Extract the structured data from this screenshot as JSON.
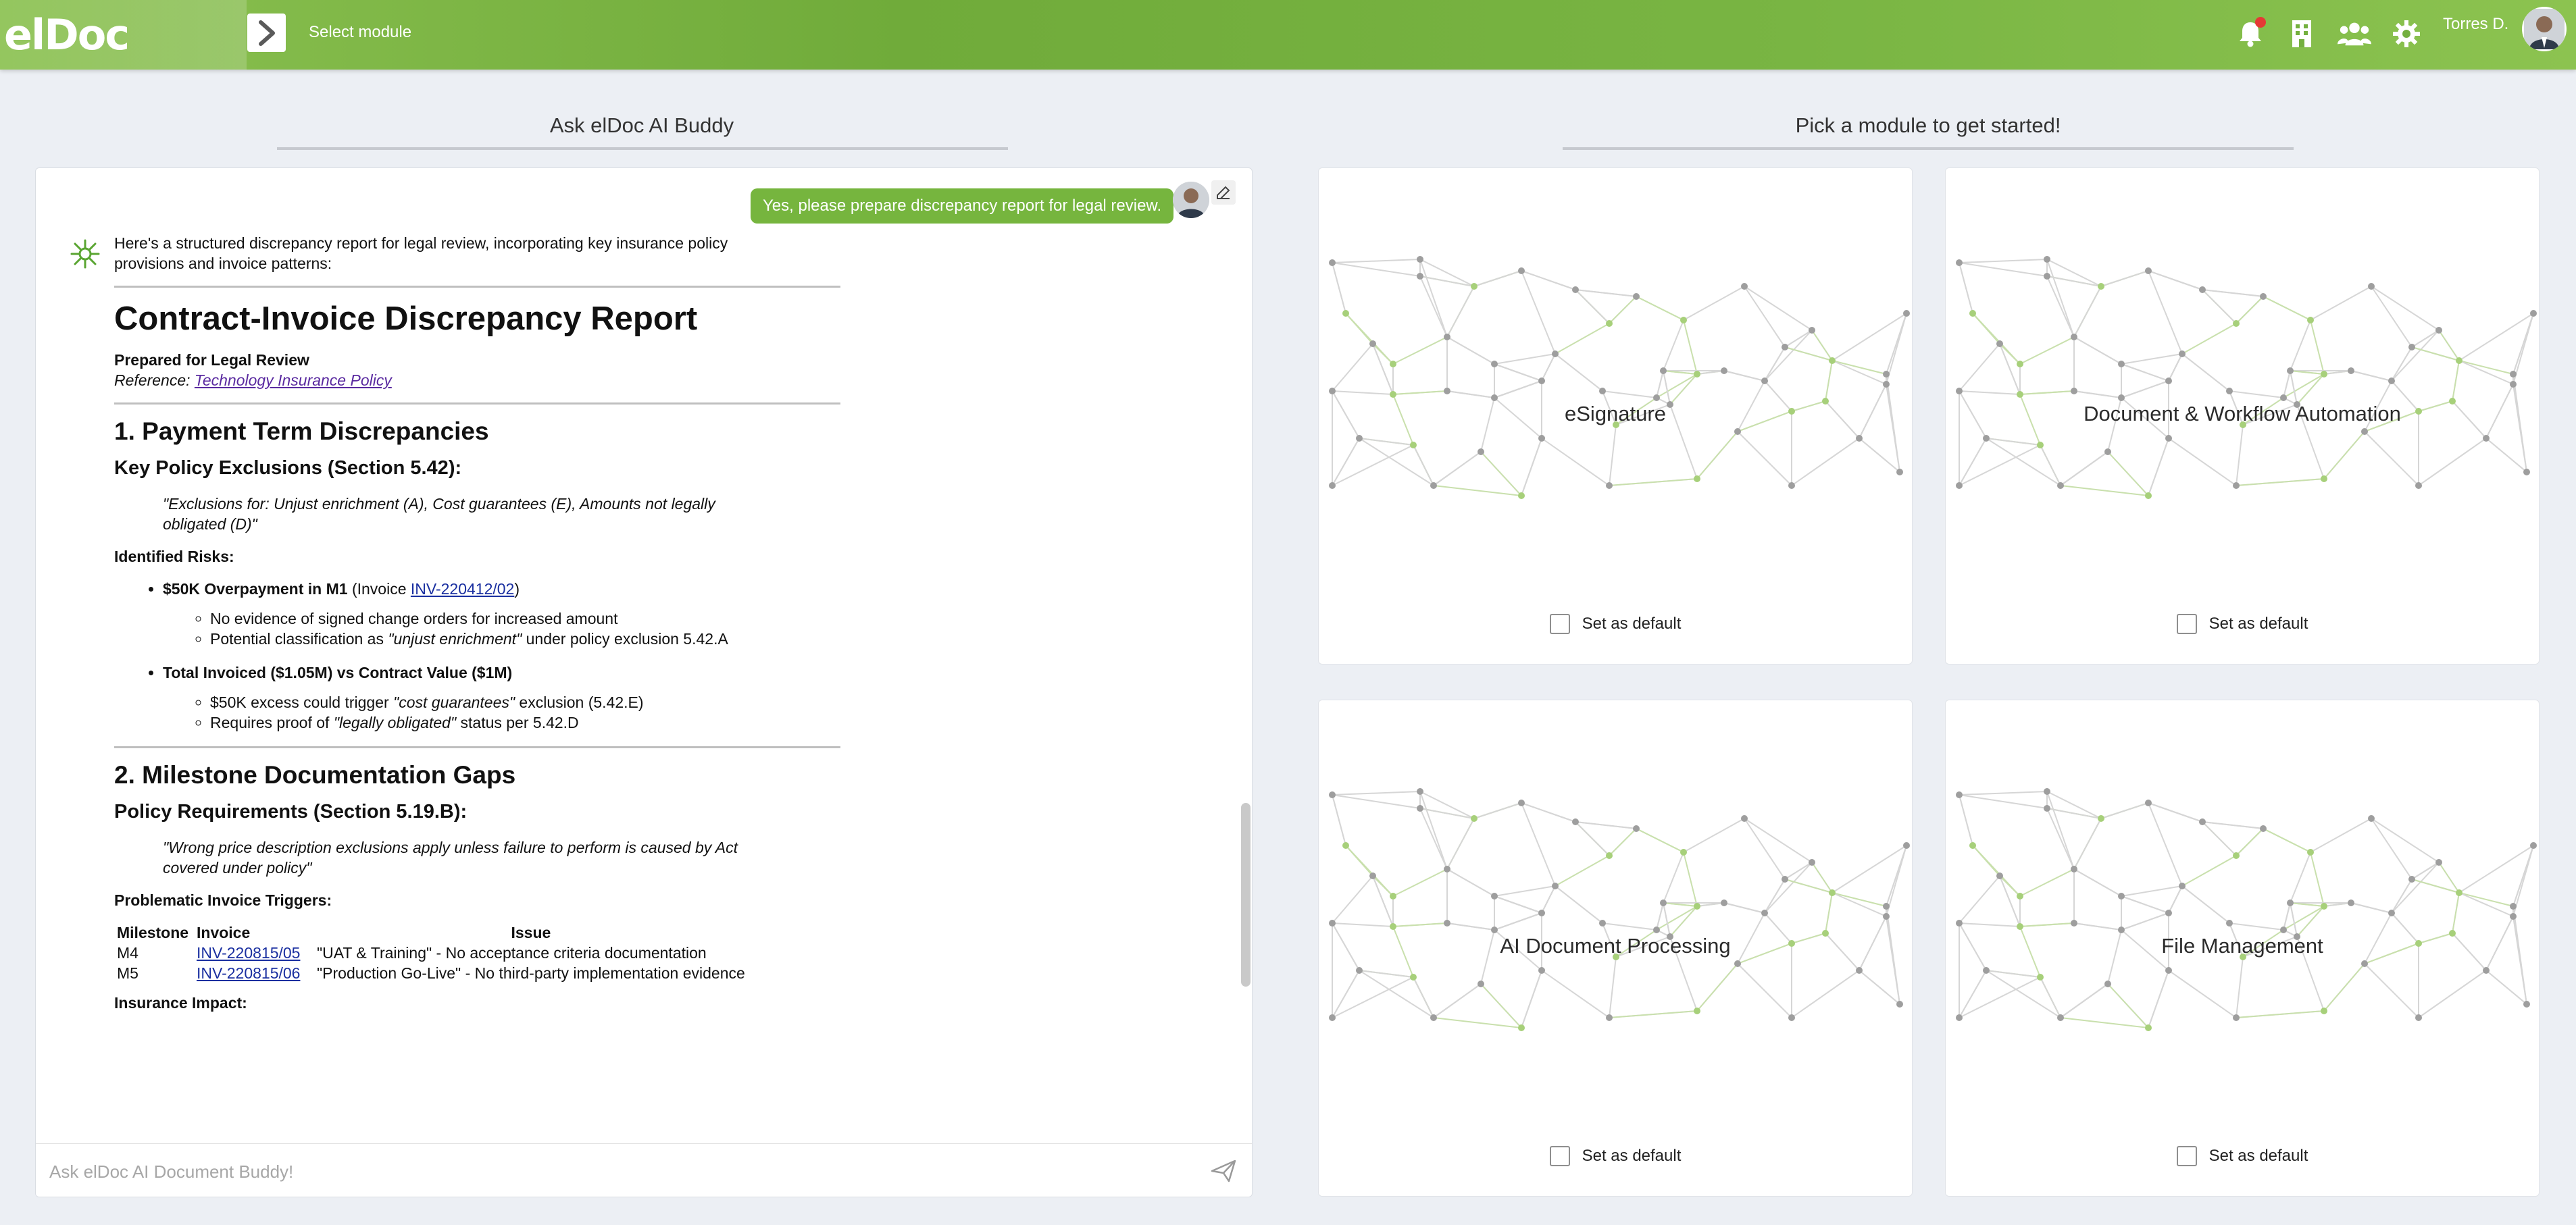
{
  "app": {
    "logo_text": "elDoc",
    "select_module_label": "Select module"
  },
  "topbar": {
    "user_name": "Torres D.",
    "icons": [
      "bell-icon",
      "building-icon",
      "users-icon",
      "gear-icon"
    ]
  },
  "left": {
    "title": "Ask elDoc AI Buddy"
  },
  "right": {
    "title": "Pick a module to get started!"
  },
  "chat": {
    "user_message": "Yes, please prepare discrepancy report for legal review.",
    "intro": "Here's a structured discrepancy report for legal review, incorporating key insurance policy provisions and invoice patterns:",
    "report_title": "Contract-Invoice Discrepancy Report",
    "prepared_for": "Prepared for Legal Review",
    "reference_label": "Reference:",
    "reference_link": "Technology Insurance Policy",
    "s1_title": "1. Payment Term Discrepancies",
    "s1_subtitle": "Key Policy Exclusions (Section 5.42):",
    "s1_quote": "\"Exclusions for: Unjust enrichment (A), Cost guarantees (E), Amounts not legally obligated (D)\"",
    "identified_risks": "Identified Risks:",
    "risk1_bold": "$50K Overpayment in M1",
    "risk1_mid": " (Invoice ",
    "risk1_link": "INV-220412/02",
    "risk1_end": ")",
    "risk1_sub1": "No evidence of signed change orders for increased amount",
    "risk1_sub2_pre": "Potential classification as ",
    "risk1_sub2_em": "\"unjust enrichment\"",
    "risk1_sub2_post": " under policy exclusion 5.42.A",
    "risk2_bold": "Total Invoiced ($1.05M) vs Contract Value ($1M)",
    "risk2_sub1_pre": "$50K excess could trigger ",
    "risk2_sub1_em": "\"cost guarantees\"",
    "risk2_sub1_post": " exclusion (5.42.E)",
    "risk2_sub2_pre": "Requires proof of ",
    "risk2_sub2_em": "\"legally obligated\"",
    "risk2_sub2_post": " status per 5.42.D",
    "s2_title": "2. Milestone Documentation Gaps",
    "s2_subtitle": "Policy Requirements (Section 5.19.B):",
    "s2_quote": "\"Wrong price description exclusions apply unless failure to perform is caused by Act covered under policy\"",
    "triggers_label": "Problematic Invoice Triggers:",
    "table": {
      "headers": [
        "Milestone",
        "Invoice",
        "Issue"
      ],
      "rows": [
        [
          "M4",
          "INV-220815/05",
          "\"UAT & Training\" - No acceptance criteria documentation"
        ],
        [
          "M5",
          "INV-220815/06",
          "\"Production Go-Live\" - No third-party implementation evidence"
        ]
      ]
    },
    "insurance_impact": "Insurance Impact:",
    "input_placeholder": "Ask elDoc AI Document Buddy!"
  },
  "modules": [
    {
      "title": "eSignature",
      "default_label": "Set as default",
      "checked": false
    },
    {
      "title": "Document & Workflow Automation",
      "default_label": "Set as default",
      "checked": false
    },
    {
      "title": "AI Document Processing",
      "default_label": "Set as default",
      "checked": false
    },
    {
      "title": "File Management",
      "default_label": "Set as default",
      "checked": false
    }
  ],
  "colors": {
    "accent_green": "#76b53e",
    "topbar_green": "#70ab3a",
    "link_blue": "#1a2fa0"
  }
}
